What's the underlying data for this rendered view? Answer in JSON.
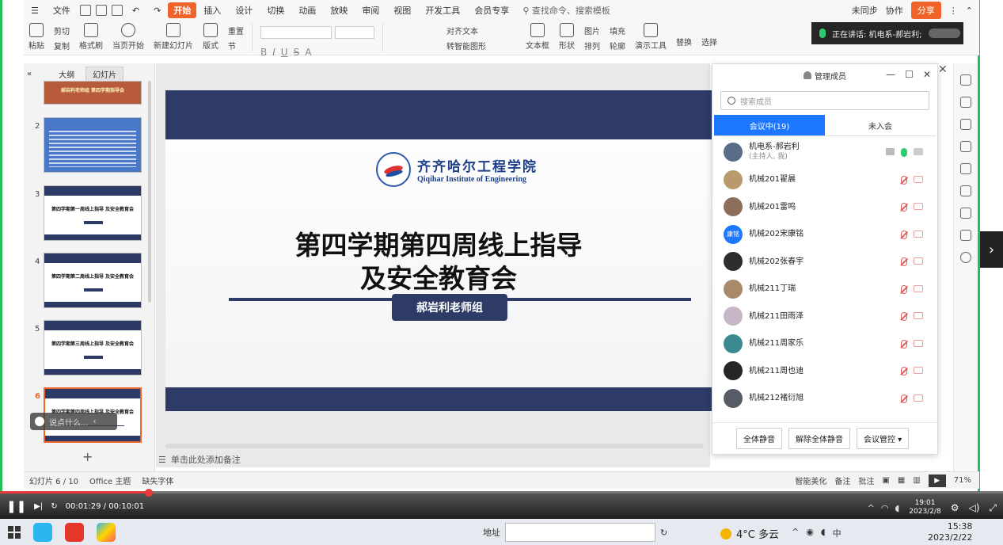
{
  "menubar": {
    "file": "文件",
    "tabs": [
      "开始",
      "插入",
      "设计",
      "切换",
      "动画",
      "放映",
      "审阅",
      "视图",
      "开发工具",
      "会员专享"
    ],
    "active_tab": "开始",
    "search_placeholder": "查找命令、搜索模板",
    "unsynced": "未同步",
    "collab": "协作",
    "share": "分享"
  },
  "ribbon": {
    "paste": "粘贴",
    "cut": "剪切",
    "copy": "复制",
    "format_painter": "格式刷",
    "play_from_current": "当页开始",
    "new_slide": "新建幻灯片",
    "layout": "版式",
    "section": "节",
    "reset": "重置",
    "align_text": "对齐文本",
    "smart_shape": "转智能图形",
    "textbox": "文本框",
    "shape": "形状",
    "arrange": "排列",
    "picture": "图片",
    "fill": "填充",
    "outline": "轮廓",
    "presenter_tools": "演示工具",
    "replace": "替换",
    "select": "选择"
  },
  "speaking": {
    "label": "正在讲话: 机电系-郝岩利;"
  },
  "leftpanel": {
    "tab_outline": "大纲",
    "tab_slides": "幻灯片",
    "thumbs": [
      {
        "num": "",
        "title": "郝岩利老师组 第四学期指导会"
      },
      {
        "num": "2",
        "title": ""
      },
      {
        "num": "3",
        "title": "第四学期第一周线上指导 及安全教育会"
      },
      {
        "num": "4",
        "title": "第四学期第二周线上指导 及安全教育会"
      },
      {
        "num": "5",
        "title": "第四学期第三周线上指导 及安全教育会"
      },
      {
        "num": "6",
        "title": "第四学期第四周线上指导 及安全教育会"
      }
    ],
    "say_placeholder": "说点什么..."
  },
  "slide": {
    "school_cn": "齐齐哈尔工程学院",
    "school_en": "Qiqihar Institute of Engineering",
    "title_line1": "第四学期第四周线上指导",
    "title_line2": "及安全教育会",
    "group_label": "郝岩利老师组"
  },
  "notes_placeholder": "单击此处添加备注",
  "members": {
    "header": "管理成员",
    "search_placeholder": "搜索成员",
    "tab_in_meeting": "会议中(19)",
    "tab_not_joined": "未入会",
    "list": [
      {
        "name": "机电系-郝岩利",
        "sub": "(主持人, 我)",
        "avatar_text": "",
        "avatar_color": "#5b6b8a",
        "host": true
      },
      {
        "name": "机械201翟晨",
        "sub": "",
        "avatar_text": "",
        "avatar_color": "#b89a6e",
        "host": false
      },
      {
        "name": "机械201雷鸣",
        "sub": "",
        "avatar_text": "",
        "avatar_color": "#8d6e5a",
        "host": false
      },
      {
        "name": "机械202宋康铭",
        "sub": "",
        "avatar_text": "康铭",
        "avatar_color": "#1e78ff",
        "host": false
      },
      {
        "name": "机械202张春宇",
        "sub": "",
        "avatar_text": "",
        "avatar_color": "#2d2d2d",
        "host": false
      },
      {
        "name": "机械211丁瑞",
        "sub": "",
        "avatar_text": "",
        "avatar_color": "#a88a6a",
        "host": false
      },
      {
        "name": "机械211田雨泽",
        "sub": "",
        "avatar_text": "",
        "avatar_color": "#c7b6c6",
        "host": false
      },
      {
        "name": "机械211周家乐",
        "sub": "",
        "avatar_text": "",
        "avatar_color": "#3a8a8f",
        "host": false
      },
      {
        "name": "机械211周也迪",
        "sub": "",
        "avatar_text": "",
        "avatar_color": "#262626",
        "host": false
      },
      {
        "name": "机械212褚衍旭",
        "sub": "",
        "avatar_text": "",
        "avatar_color": "#555c66",
        "host": false
      }
    ],
    "btn_mute_all": "全体静音",
    "btn_unmute_all": "解除全体静音",
    "btn_control": "会议管控"
  },
  "statusbar": {
    "slide_info": "幻灯片 6 / 10",
    "theme": "Office 主题",
    "missing_font": "缺失字体",
    "smart_beautify": "智能美化",
    "notes": "备注",
    "comment": "批注",
    "zoom": "71%"
  },
  "video": {
    "time": "00:01:29 / 00:10:01",
    "progress": 0.148,
    "clock_time": "19:01",
    "clock_date": "2023/2/8"
  },
  "taskbar": {
    "address_label": "地址",
    "weather": "4°C  多云",
    "time": "15:38",
    "date": "2023/2/22"
  }
}
